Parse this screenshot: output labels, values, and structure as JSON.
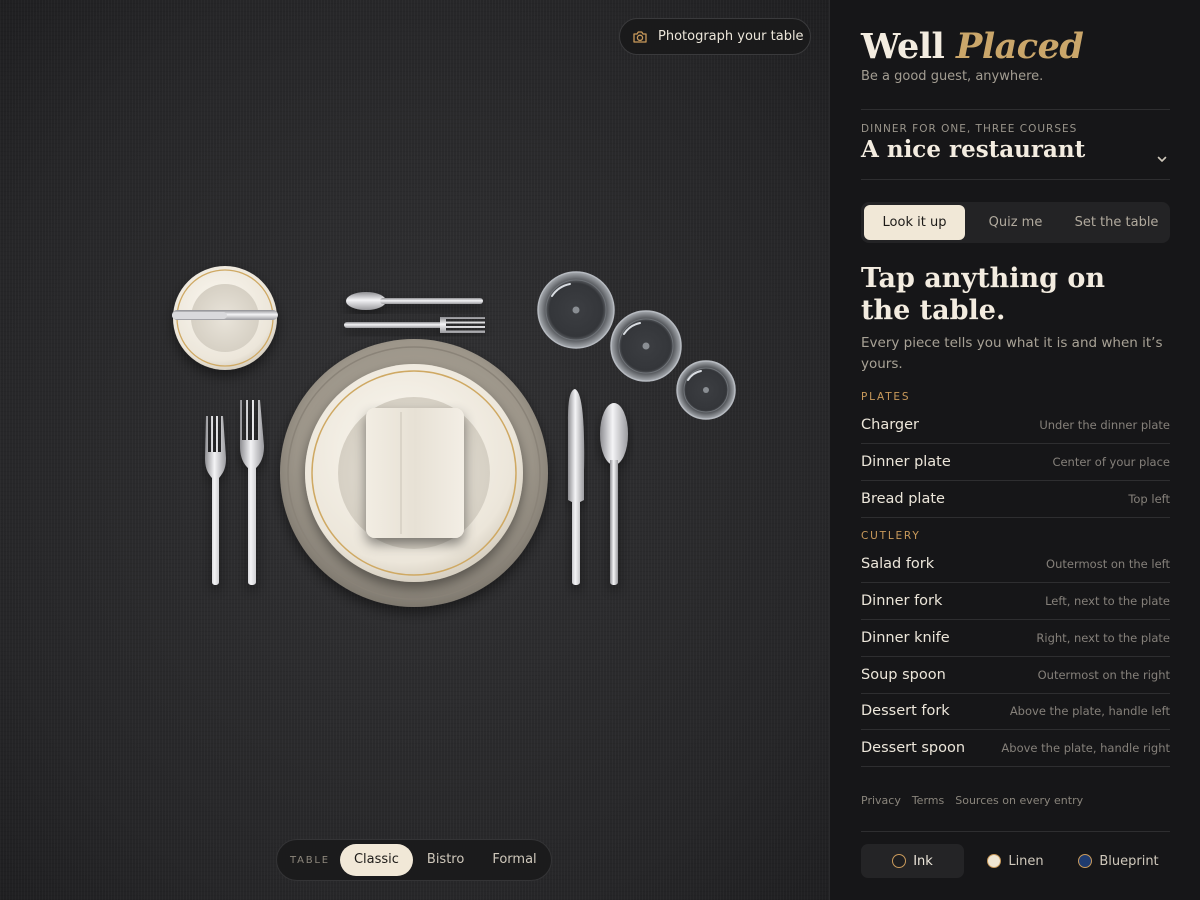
{
  "table": {
    "photo_button": "Photograph your table",
    "switch_label": "TABLE",
    "styles": [
      "Classic",
      "Bistro",
      "Formal"
    ],
    "active_style": "Classic"
  },
  "panel": {
    "brand_main": "Well",
    "brand_accent": "Placed",
    "tagline": "Be a good guest, anywhere.",
    "scene_kicker": "DINNER FOR ONE, THREE COURSES",
    "scene_title": "A nice restaurant",
    "tabs": [
      "Look it up",
      "Quiz me",
      "Set the table"
    ],
    "active_tab": "Look it up",
    "headline": "Tap anything on the table.",
    "lede": "Every piece tells you what it is and when it’s yours.",
    "sections": [
      {
        "title": "PLATES",
        "items": [
          {
            "name": "Charger",
            "where": "Under the dinner plate"
          },
          {
            "name": "Dinner plate",
            "where": "Center of your place"
          },
          {
            "name": "Bread plate",
            "where": "Top left"
          }
        ]
      },
      {
        "title": "CUTLERY",
        "items": [
          {
            "name": "Salad fork",
            "where": "Outermost on the left"
          },
          {
            "name": "Dinner fork",
            "where": "Left, next to the plate"
          },
          {
            "name": "Dinner knife",
            "where": "Right, next to the plate"
          },
          {
            "name": "Soup spoon",
            "where": "Outermost on the right"
          },
          {
            "name": "Dessert fork",
            "where": "Above the plate, handle left"
          },
          {
            "name": "Dessert spoon",
            "where": "Above the plate, handle right"
          }
        ]
      }
    ],
    "footer_links": [
      "Privacy",
      "Terms",
      "Sources on every entry"
    ],
    "themes": [
      {
        "name": "Ink",
        "swatch": "#1e1e20",
        "ring": "#c99a5b"
      },
      {
        "name": "Linen",
        "swatch": "#efe6d3",
        "ring": "#c99a5b"
      },
      {
        "name": "Blueprint",
        "swatch": "#1f3b6e",
        "ring": "#c99a5b"
      }
    ],
    "active_theme": "Ink"
  },
  "colors": {
    "accent": "#caa66a",
    "section_head": "#c99a5b",
    "active_pill": "#f1e8d7",
    "panel_bg": "#161618",
    "table_bg": "#2b2b2d"
  },
  "icons": {
    "photo": "camera-icon",
    "scene_toggle": "chevron-down-icon"
  }
}
